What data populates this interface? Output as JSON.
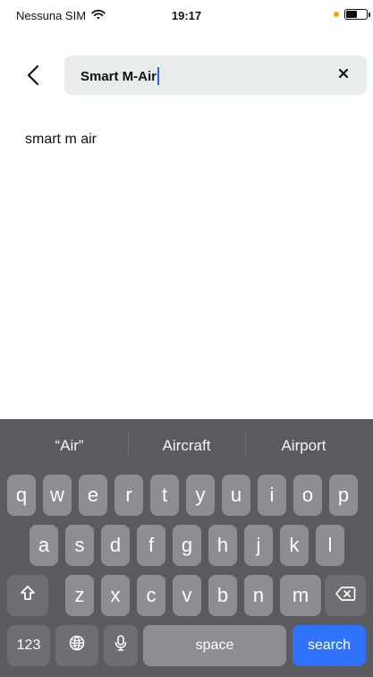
{
  "status_bar": {
    "carrier": "Nessuna SIM",
    "time": "19:17",
    "orange_dot_color": "#ff9f0a"
  },
  "search": {
    "query": "Smart M-Air",
    "back_icon": "chevron-left-icon",
    "clear_icon": "close-icon"
  },
  "suggestions": [
    "smart m air"
  ],
  "keyboard": {
    "predictions": [
      "“Air”",
      "Aircraft",
      "Airport"
    ],
    "row1": [
      "q",
      "w",
      "e",
      "r",
      "t",
      "y",
      "u",
      "i",
      "o",
      "p"
    ],
    "row2": [
      "a",
      "s",
      "d",
      "f",
      "g",
      "h",
      "j",
      "k",
      "l"
    ],
    "row3": [
      "z",
      "x",
      "c",
      "v",
      "b",
      "n",
      "m"
    ],
    "bottom_row": {
      "numbers": "123",
      "globe_icon": "globe-icon",
      "mic_icon": "microphone-icon",
      "space": "space",
      "search": "search"
    },
    "shift_icon": "shift-icon",
    "delete_icon": "delete-icon",
    "colors": {
      "keyboard_bg": "#5b5b5f",
      "key_bg": "#8e8e92",
      "accent": "#2f73ff"
    }
  }
}
